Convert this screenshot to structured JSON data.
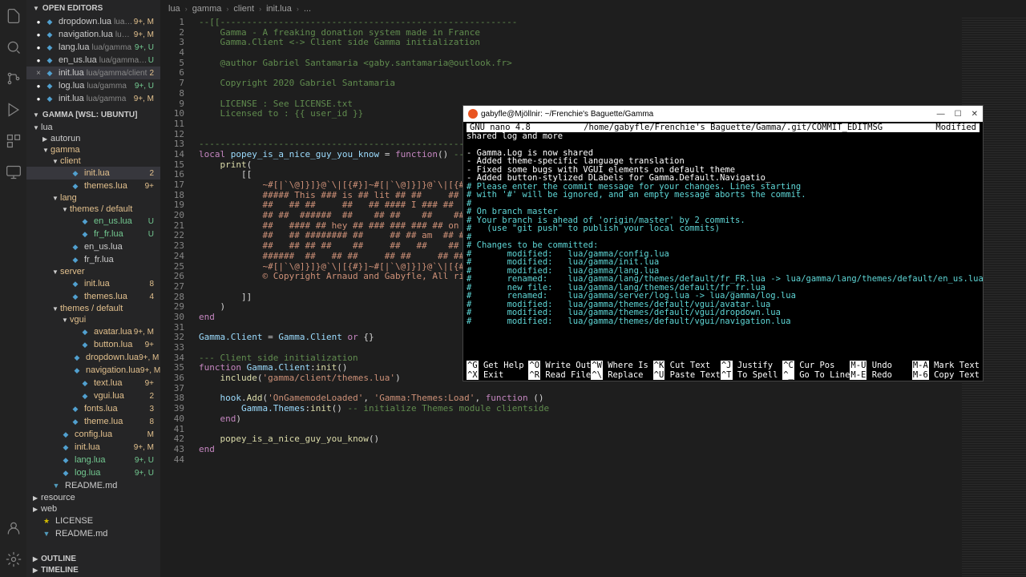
{
  "activitybar": {
    "icons": [
      "files-icon",
      "search-icon",
      "source-control-icon",
      "debug-icon",
      "extensions-icon",
      "remote-icon"
    ],
    "bottom": [
      "account-icon",
      "gear-icon"
    ]
  },
  "sidebar": {
    "open_editors_label": "OPEN EDITORS",
    "open_editors": [
      {
        "name": "dropdown.lua",
        "path": "lua/gamm...",
        "badge": "9+, M",
        "cls": "m"
      },
      {
        "name": "navigation.lua",
        "path": "lua/gam...",
        "badge": "9+, M",
        "cls": "m"
      },
      {
        "name": "lang.lua",
        "path": "lua/gamma",
        "badge": "9+, U",
        "cls": "u"
      },
      {
        "name": "en_us.lua",
        "path": "lua/gamma/lang/th...",
        "badge": "U",
        "cls": "u"
      },
      {
        "name": "init.lua",
        "path": "lua/gamma/client",
        "badge": "2",
        "cls": "n",
        "active": true,
        "close": true
      },
      {
        "name": "log.lua",
        "path": "lua/gamma",
        "badge": "9+, U",
        "cls": "u"
      },
      {
        "name": "init.lua",
        "path": "lua/gamma",
        "badge": "9+, M",
        "cls": "m"
      }
    ],
    "workspace_label": "GAMMA [WSL: UBUNTU]",
    "tree": [
      {
        "name": "lua",
        "type": "folder",
        "depth": 0,
        "open": true
      },
      {
        "name": "autorun",
        "type": "folder",
        "depth": 1
      },
      {
        "name": "gamma",
        "type": "folder",
        "depth": 1,
        "open": true,
        "cls": "m"
      },
      {
        "name": "client",
        "type": "folder",
        "depth": 2,
        "open": true,
        "cls": "m"
      },
      {
        "name": "init.lua",
        "type": "lua",
        "depth": 3,
        "badge": "2",
        "cls": "n",
        "active": true
      },
      {
        "name": "themes.lua",
        "type": "lua",
        "depth": 3,
        "badge": "9+",
        "cls": "m"
      },
      {
        "name": "lang",
        "type": "folder",
        "depth": 2,
        "open": true,
        "cls": "m"
      },
      {
        "name": "themes / default",
        "type": "folder",
        "depth": 3,
        "open": true,
        "cls": "m"
      },
      {
        "name": "en_us.lua",
        "type": "lua",
        "depth": 4,
        "badge": "U",
        "cls": "u"
      },
      {
        "name": "fr_fr.lua",
        "type": "lua",
        "depth": 4,
        "badge": "U",
        "cls": "u"
      },
      {
        "name": "en_us.lua",
        "type": "lua",
        "depth": 3
      },
      {
        "name": "fr_fr.lua",
        "type": "lua",
        "depth": 3
      },
      {
        "name": "server",
        "type": "folder",
        "depth": 2,
        "open": true,
        "cls": "m"
      },
      {
        "name": "init.lua",
        "type": "lua",
        "depth": 3,
        "badge": "8",
        "cls": "n"
      },
      {
        "name": "themes.lua",
        "type": "lua",
        "depth": 3,
        "badge": "4",
        "cls": "n"
      },
      {
        "name": "themes / default",
        "type": "folder",
        "depth": 2,
        "open": true,
        "cls": "m"
      },
      {
        "name": "vgui",
        "type": "folder",
        "depth": 3,
        "open": true,
        "cls": "m"
      },
      {
        "name": "avatar.lua",
        "type": "lua",
        "depth": 4,
        "badge": "9+, M",
        "cls": "m"
      },
      {
        "name": "button.lua",
        "type": "lua",
        "depth": 4,
        "badge": "9+",
        "cls": "m"
      },
      {
        "name": "dropdown.lua",
        "type": "lua",
        "depth": 4,
        "badge": "9+, M",
        "cls": "m"
      },
      {
        "name": "navigation.lua",
        "type": "lua",
        "depth": 4,
        "badge": "9+, M",
        "cls": "m"
      },
      {
        "name": "text.lua",
        "type": "lua",
        "depth": 4,
        "badge": "9+",
        "cls": "m"
      },
      {
        "name": "vgui.lua",
        "type": "lua",
        "depth": 4,
        "badge": "2",
        "cls": "n"
      },
      {
        "name": "fonts.lua",
        "type": "lua",
        "depth": 3,
        "badge": "3",
        "cls": "n"
      },
      {
        "name": "theme.lua",
        "type": "lua",
        "depth": 3,
        "badge": "8",
        "cls": "n"
      },
      {
        "name": "config.lua",
        "type": "lua",
        "depth": 2,
        "badge": "M",
        "cls": "m"
      },
      {
        "name": "init.lua",
        "type": "lua",
        "depth": 2,
        "badge": "9+, M",
        "cls": "m"
      },
      {
        "name": "lang.lua",
        "type": "lua",
        "depth": 2,
        "badge": "9+, U",
        "cls": "u"
      },
      {
        "name": "log.lua",
        "type": "lua",
        "depth": 2,
        "badge": "9+, U",
        "cls": "u"
      },
      {
        "name": "README.md",
        "type": "md",
        "depth": 1
      },
      {
        "name": "resource",
        "type": "folder",
        "depth": 0
      },
      {
        "name": "web",
        "type": "folder",
        "depth": 0
      },
      {
        "name": "LICENSE",
        "type": "lic",
        "depth": 0
      },
      {
        "name": "README.md",
        "type": "md",
        "depth": 0
      }
    ],
    "outline_label": "OUTLINE",
    "timeline_label": "TIMELINE"
  },
  "breadcrumb": [
    "lua",
    "gamma",
    "client",
    "init.lua",
    "..."
  ],
  "code": {
    "lines": [
      {
        "n": 1,
        "html": "<span class='c-comment'>--[[--------------------------------------------------------</span>"
      },
      {
        "n": 2,
        "html": "<span class='c-comment'>    Gamma - A freaking donation system made in France</span>"
      },
      {
        "n": 3,
        "html": "<span class='c-comment'>    Gamma.Client &lt;-&gt; Client side Gamma initialization</span>"
      },
      {
        "n": 4,
        "html": ""
      },
      {
        "n": 5,
        "html": "<span class='c-comment'>    @author Gabriel Santamaria &lt;gaby.santamaria@outlook.fr&gt;</span>"
      },
      {
        "n": 6,
        "html": ""
      },
      {
        "n": 7,
        "html": "<span class='c-comment'>    Copyright 2020 Gabriel Santamaria</span>"
      },
      {
        "n": 8,
        "html": ""
      },
      {
        "n": 9,
        "html": "<span class='c-comment'>    LICENSE : See LICENSE.txt</span>"
      },
      {
        "n": 10,
        "html": "<span class='c-comment'>    Licensed to : {{ user_id }}</span>"
      },
      {
        "n": 11,
        "html": ""
      },
      {
        "n": 12,
        "html": ""
      },
      {
        "n": 13,
        "html": "<span class='c-comment'>----------------------------------------------------------]]</span>"
      },
      {
        "n": 14,
        "html": "<span class='c-keyword'>local</span> <span class='c-var'>popey_is_a_nice_guy_you_know</span> <span class='c-punct'>=</span> <span class='c-keyword'>function</span><span class='c-punct'>()</span> <span class='c-comment'>-- don't you kno</span>"
      },
      {
        "n": 15,
        "html": "    <span class='c-func'>print</span><span class='c-punct'>(</span>"
      },
      {
        "n": 16,
        "html": "        <span class='c-punct'>[[</span>"
      },
      {
        "n": 17,
        "html": "<span class='c-string'>            ~#[|`\\@]}]}@`\\|[{#}]~#[|`\\@]}]}@`\\|[{#}]~#[|`\\@</span>"
      },
      {
        "n": 18,
        "html": "<span class='c-string'>            ##### This ### is ## lit ## ##     ##     ##</span>"
      },
      {
        "n": 19,
        "html": "<span class='c-string'>            ##   ## ##     ##   ## #### I ### ##   ##</span>"
      },
      {
        "n": 20,
        "html": "<span class='c-string'>            ## ##  ######  ##    ## ##    ##    ##  ##</span>"
      },
      {
        "n": 21,
        "html": "<span class='c-string'>            ##   #### ## hey ## ### ### ### ## on ## ## ###</span>"
      },
      {
        "n": 22,
        "html": "<span class='c-string'>            ##   ## ######## ##     ## ## am  ## ## Ir  ## ##</span>"
      },
      {
        "n": 23,
        "html": "<span class='c-string'>            ##   ## ## ##    ##     ##   ##    ## ##   on ##</span>"
      },
      {
        "n": 24,
        "html": "<span class='c-string'>            ######  ##   ## ##     ## ##     ## ## Man ## ###</span>"
      },
      {
        "n": 25,
        "html": "<span class='c-string'>            ~#[|`\\@]}]}@`\\|[{#}]~#[|`\\@]}]}@`\\|[{#}]~#[|`\\@</span>"
      },
      {
        "n": 26,
        "html": "<span class='c-string'>            © Copyright Arnaud and Gabyfle, All rights reserved</span>"
      },
      {
        "n": 27,
        "html": ""
      },
      {
        "n": 28,
        "html": "        <span class='c-punct'>]]</span>"
      },
      {
        "n": 29,
        "html": "    <span class='c-punct'>)</span>"
      },
      {
        "n": 30,
        "html": "<span class='c-keyword'>end</span>"
      },
      {
        "n": 31,
        "html": ""
      },
      {
        "n": 32,
        "html": "<span class='c-var'>Gamma.Client</span> <span class='c-punct'>=</span> <span class='c-var'>Gamma.Client</span> <span class='c-keyword'>or</span> <span class='c-punct'>{}</span>"
      },
      {
        "n": 33,
        "html": ""
      },
      {
        "n": 34,
        "html": "<span class='c-comment'>--- Client side initialization</span>"
      },
      {
        "n": 35,
        "html": "<span class='c-keyword'>function</span> <span class='c-var'>Gamma.Client</span><span class='c-punct'>:</span><span class='c-func'>init</span><span class='c-punct'>()</span>"
      },
      {
        "n": 36,
        "html": "    <span class='c-func'>include</span><span class='c-punct'>(</span><span class='c-string'>'gamma/client/themes.lua'</span><span class='c-punct'>)</span>"
      },
      {
        "n": 37,
        "html": ""
      },
      {
        "n": 38,
        "html": "    <span class='c-var'>hook</span><span class='c-punct'>.</span><span class='c-func'>Add</span><span class='c-punct'>(</span><span class='c-string'>'OnGamemodeLoaded'</span><span class='c-punct'>,</span> <span class='c-string'>'Gamma:Themes:Load'</span><span class='c-punct'>,</span> <span class='c-keyword'>function</span> <span class='c-punct'>()</span>"
      },
      {
        "n": 39,
        "html": "        <span class='c-var'>Gamma.Themes</span><span class='c-punct'>:</span><span class='c-func'>init</span><span class='c-punct'>()</span> <span class='c-comment'>-- initialize Themes module clientside</span>"
      },
      {
        "n": 40,
        "html": "    <span class='c-keyword'>end</span><span class='c-punct'>)</span>"
      },
      {
        "n": 41,
        "html": ""
      },
      {
        "n": 42,
        "html": "    <span class='c-func'>popey_is_a_nice_guy_you_know</span><span class='c-punct'>()</span>"
      },
      {
        "n": 43,
        "html": "<span class='c-keyword'>end</span>"
      },
      {
        "n": 44,
        "html": ""
      }
    ]
  },
  "terminal": {
    "title": "gabyfle@Mjöllnir: ~/Frenchie's Baguette/Gamma",
    "nano_version": "GNU nano 4.8",
    "filepath": "/home/gabyfle/Frenchie's Baguette/Gamma/.git/COMMIT_EDITMSG",
    "modified": "Modified",
    "lines": [
      {
        "txt": "shared log and more",
        "cls": "t-white"
      },
      {
        "txt": "",
        "cls": ""
      },
      {
        "txt": "- Gamma.Log is now shared",
        "cls": "t-white"
      },
      {
        "txt": "- Added theme-specific language translation",
        "cls": "t-white"
      },
      {
        "txt": "- Fixed some bugs with VGUI elements on default theme",
        "cls": "t-white"
      },
      {
        "txt": "- Added button-stylized DLabels for Gamma.Default.Navigatio_",
        "cls": "t-white"
      },
      {
        "txt": "# Please enter the commit message for your changes. Lines starting",
        "cls": "t-cyan"
      },
      {
        "txt": "# with '#' will be ignored, and an empty message aborts the commit.",
        "cls": "t-cyan"
      },
      {
        "txt": "#",
        "cls": "t-cyan"
      },
      {
        "txt": "# On branch master",
        "cls": "t-cyan"
      },
      {
        "txt": "# Your branch is ahead of 'origin/master' by 2 commits.",
        "cls": "t-cyan"
      },
      {
        "txt": "#   (use \"git push\" to publish your local commits)",
        "cls": "t-cyan"
      },
      {
        "txt": "#",
        "cls": "t-cyan"
      },
      {
        "txt": "# Changes to be committed:",
        "cls": "t-cyan"
      },
      {
        "txt": "#       modified:   lua/gamma/config.lua",
        "cls": "t-cyan"
      },
      {
        "txt": "#       modified:   lua/gamma/init.lua",
        "cls": "t-cyan"
      },
      {
        "txt": "#       modified:   lua/gamma/lang.lua",
        "cls": "t-cyan"
      },
      {
        "txt": "#       renamed:    lua/gamma/lang/themes/default/fr_FR.lua -> lua/gamma/lang/themes/default/en_us.lua",
        "cls": "t-cyan"
      },
      {
        "txt": "#       new file:   lua/gamma/lang/themes/default/fr_fr.lua",
        "cls": "t-cyan"
      },
      {
        "txt": "#       renamed:    lua/gamma/server/log.lua -> lua/gamma/log.lua",
        "cls": "t-cyan"
      },
      {
        "txt": "#       modified:   lua/gamma/themes/default/vgui/avatar.lua",
        "cls": "t-cyan"
      },
      {
        "txt": "#       modified:   lua/gamma/themes/default/vgui/dropdown.lua",
        "cls": "t-cyan"
      },
      {
        "txt": "#       modified:   lua/gamma/themes/default/vgui/navigation.lua",
        "cls": "t-cyan"
      }
    ],
    "shortcuts": [
      {
        "k": "^G",
        "l": "Get Help"
      },
      {
        "k": "^O",
        "l": "Write Out"
      },
      {
        "k": "^W",
        "l": "Where Is"
      },
      {
        "k": "^K",
        "l": "Cut Text"
      },
      {
        "k": "^J",
        "l": "Justify"
      },
      {
        "k": "^C",
        "l": "Cur Pos"
      },
      {
        "k": "M-U",
        "l": "Undo"
      },
      {
        "k": "M-A",
        "l": "Mark Text"
      },
      {
        "k": "^X",
        "l": "Exit"
      },
      {
        "k": "^R",
        "l": "Read File"
      },
      {
        "k": "^\\",
        "l": "Replace"
      },
      {
        "k": "^U",
        "l": "Paste Text"
      },
      {
        "k": "^T",
        "l": "To Spell"
      },
      {
        "k": "^_",
        "l": "Go To Line"
      },
      {
        "k": "M-E",
        "l": "Redo"
      },
      {
        "k": "M-6",
        "l": "Copy Text"
      }
    ]
  }
}
